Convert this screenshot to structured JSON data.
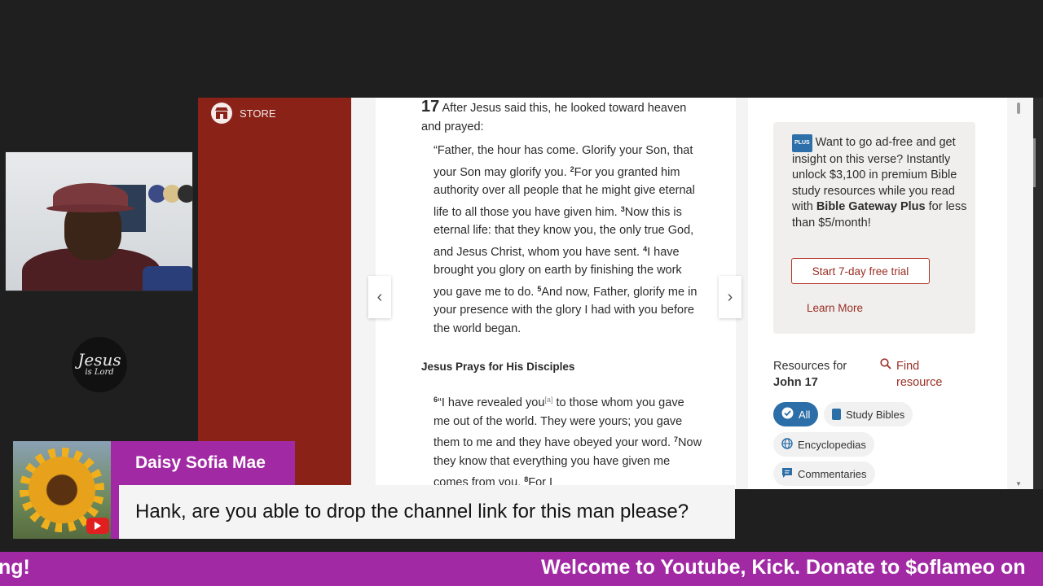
{
  "browser": {
    "store_label": "STORE",
    "passage": {
      "chapter": "17",
      "intro": "After Jesus said this, he looked toward heaven and prayed:",
      "quote_parts": [
        {
          "text": "“Father, the hour has come. Glorify your Son, that your Son may glorify you. "
        },
        {
          "verse": "2",
          "text": "For you granted him authority over all people that he might give eternal life to all those you have given him. "
        },
        {
          "verse": "3",
          "text": "Now this is eternal life: that they know you, the only true God, and Jesus Christ, whom you have sent. "
        },
        {
          "verse": "4",
          "text": "I have brought you glory on earth by finishing the work you gave me to do. "
        },
        {
          "verse": "5",
          "text": "And now, Father, glorify me in your presence with the glory I had with you before the world began."
        }
      ],
      "section_heading": "Jesus Prays for His Disciples",
      "disciples": {
        "verse6": "6",
        "text6a": "“I have revealed you",
        "footnote": "[a]",
        "text6b": " to those whom you gave me out of the world. They were yours; you gave them to me and they have obeyed your word. ",
        "verse7": "7",
        "text7": "Now they know that everything you have given me comes from you. ",
        "verse8": "8",
        "text8": "For I"
      }
    },
    "nav": {
      "prev": "‹",
      "next": "›"
    },
    "plus_box": {
      "badge": "PLUS",
      "text_start": "Want to go ad-free and get insight on this verse? Instantly unlock $3,100 in premium Bible study resources while you read with ",
      "brand": "Bible Gateway Plus",
      "text_end": " for less than $5/month!",
      "trial_button": "Start 7-day free trial",
      "learn_more": "Learn More"
    },
    "resources": {
      "label": "Resources for",
      "reference": "John 17",
      "find": "Find resource",
      "filters": [
        "All",
        "Study Bibles",
        "Encyclopedias",
        "Commentaries"
      ]
    }
  },
  "overlay": {
    "channel_logo_line1": "Jesus",
    "channel_logo_line2": "is Lord",
    "chat": {
      "author": "Daisy Sofia Mae",
      "message": "Hank, are you able to drop the channel link for this man please?"
    },
    "ticker_left": "ng!",
    "ticker_main": "Welcome to Youtube, Kick. Donate to $oflameo on"
  },
  "colors": {
    "store_red": "#8a2218",
    "accent_purple": "#a12aa4",
    "link_red": "#9a2f24",
    "chip_blue": "#2c6ea7"
  }
}
